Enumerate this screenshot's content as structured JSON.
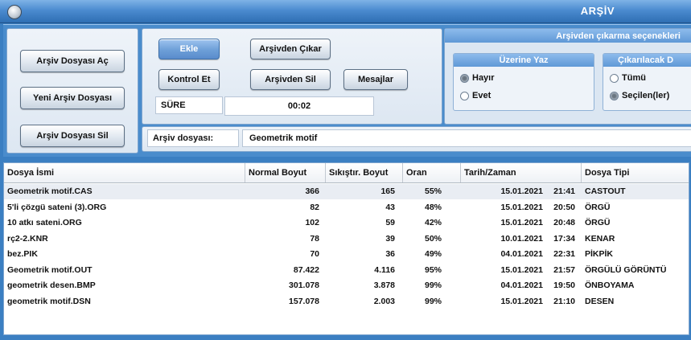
{
  "window": {
    "title": "ARŞİV"
  },
  "left_buttons": {
    "open": "Arşiv Dosyası Aç",
    "new": "Yeni Arşiv Dosyası",
    "delete": "Arşiv Dosyası Sil"
  },
  "toolbar": {
    "add": "Ekle",
    "remove_from_archive": "Arşivden Çıkar",
    "check": "Kontrol Et",
    "delete_from_archive": "Arşivden Sil",
    "messages": "Mesajlar",
    "duration_label": "SÜRE",
    "duration_value": "00:02"
  },
  "archive_file": {
    "label": "Arşiv dosyası:",
    "value": "Geometrik motif"
  },
  "options": {
    "title": "Arşivden çıkarma seçenekleri",
    "overwrite": {
      "title": "Üzerine Yaz",
      "no": "Hayır",
      "yes": "Evet",
      "selected": "no"
    },
    "extract": {
      "title": "Çıkarılacak D",
      "all": "Tümü",
      "selected_items": "Seçilen(ler)",
      "selected": "selected_items"
    }
  },
  "table": {
    "columns": [
      "Dosya İsmi",
      "Normal Boyut",
      "Sıkıştır. Boyut",
      "Oran",
      "Tarih/Zaman",
      "Dosya Tipi"
    ],
    "rows": [
      {
        "name": "Geometrik motif.CAS",
        "normal": "366",
        "compressed": "165",
        "ratio": "55%",
        "date": "15.01.2021",
        "time": "21:41",
        "type": "CASTOUT"
      },
      {
        "name": "5'li çözgü sateni (3).ORG",
        "normal": "82",
        "compressed": "43",
        "ratio": "48%",
        "date": "15.01.2021",
        "time": "20:50",
        "type": "ÖRGÜ"
      },
      {
        "name": "10 atkı sateni.ORG",
        "normal": "102",
        "compressed": "59",
        "ratio": "42%",
        "date": "15.01.2021",
        "time": "20:48",
        "type": "ÖRGÜ"
      },
      {
        "name": "rç2-2.KNR",
        "normal": "78",
        "compressed": "39",
        "ratio": "50%",
        "date": "10.01.2021",
        "time": "17:34",
        "type": "KENAR"
      },
      {
        "name": "bez.PIK",
        "normal": "70",
        "compressed": "36",
        "ratio": "49%",
        "date": "04.01.2021",
        "time": "22:31",
        "type": "PİKPİK"
      },
      {
        "name": "Geometrik motif.OUT",
        "normal": "87.422",
        "compressed": "4.116",
        "ratio": "95%",
        "date": "15.01.2021",
        "time": "21:57",
        "type": "ÖRGÜLÜ GÖRÜNTÜ"
      },
      {
        "name": "geometrik desen.BMP",
        "normal": "301.078",
        "compressed": "3.878",
        "ratio": "99%",
        "date": "04.01.2021",
        "time": "19:50",
        "type": "ÖNBOYAMA"
      },
      {
        "name": "geometrik motif.DSN",
        "normal": "157.078",
        "compressed": "2.003",
        "ratio": "99%",
        "date": "15.01.2021",
        "time": "21:10",
        "type": "DESEN"
      }
    ]
  }
}
